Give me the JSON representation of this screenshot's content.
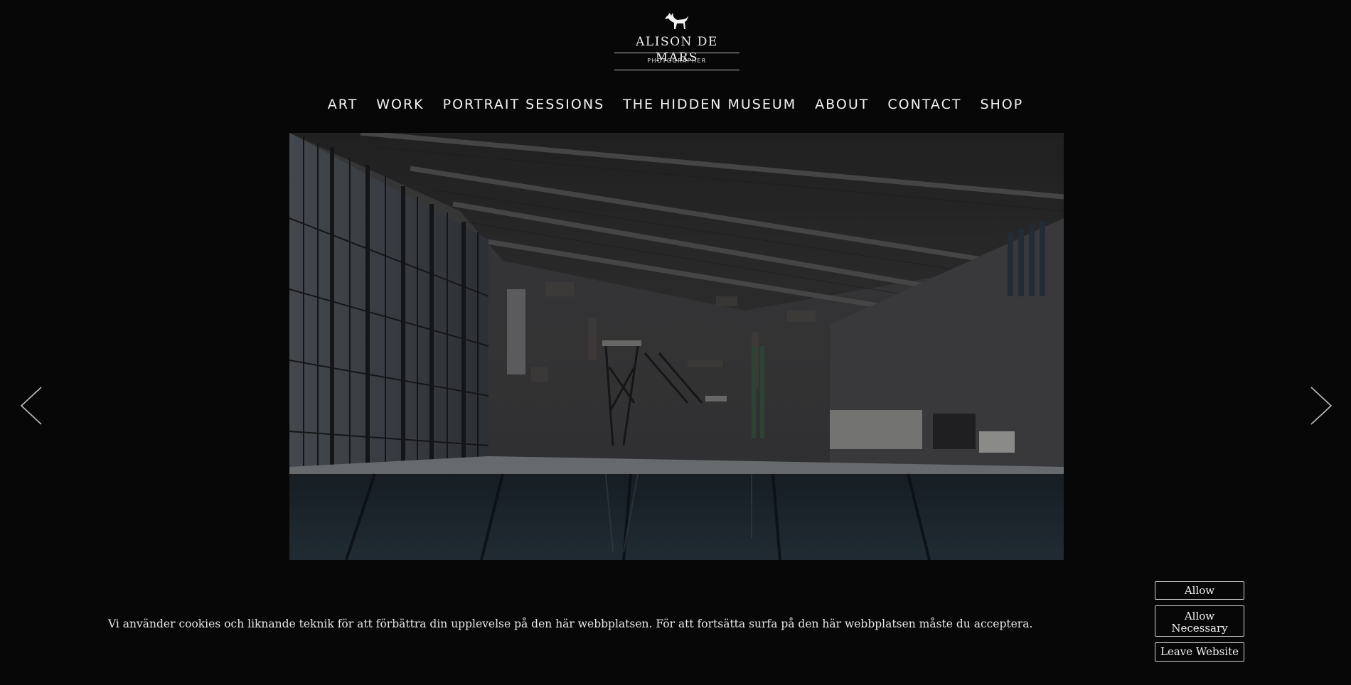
{
  "brand": {
    "name": "ALISON DE MARS",
    "tagline": "PHOTOGRAPHER",
    "logo_icon": "fox-icon"
  },
  "nav": {
    "items": [
      {
        "label": "ART"
      },
      {
        "label": "WORK"
      },
      {
        "label": "PORTRAIT SESSIONS"
      },
      {
        "label": "THE HIDDEN MUSEUM"
      },
      {
        "label": "ABOUT"
      },
      {
        "label": "CONTACT"
      },
      {
        "label": "SHOP"
      }
    ]
  },
  "gallery": {
    "prev_icon": "chevron-left-icon",
    "next_icon": "chevron-right-icon"
  },
  "cookie": {
    "message": "Vi använder cookies och liknande teknik för att förbättra din upplevelse på den här webbplatsen. För att fortsätta surfa på den här webbplatsen måste du acceptera.",
    "allow_label": "Allow",
    "allow_necessary_line1": "Allow",
    "allow_necessary_line2": "Necessary",
    "leave_label": "Leave Website"
  },
  "colors": {
    "background": "#070708",
    "text": "#f4f4f4"
  }
}
